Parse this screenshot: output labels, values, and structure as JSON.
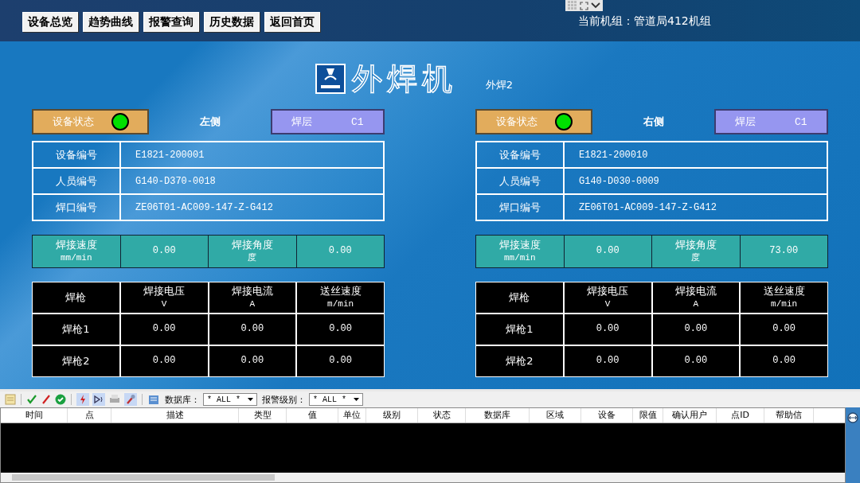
{
  "top_bar": {
    "nav_buttons": [
      "设备总览",
      "趋势曲线",
      "报警查询",
      "历史数据",
      "返回首页"
    ],
    "current_unit": "当前机组：管道局412机组"
  },
  "title": {
    "text": "外焊机",
    "subtitle": "外焊2"
  },
  "sides": [
    {
      "status_label": "设备状态",
      "status_on": true,
      "side_label": "左侧",
      "layer_label": "焊层",
      "layer_value": "C1",
      "info": [
        {
          "label": "设备编号",
          "value": "E1821-200001"
        },
        {
          "label": "人员编号",
          "value": "G140-D370-0018"
        },
        {
          "label": "焊口编号",
          "value": "ZE06T01-AC009-147-Z-G412"
        }
      ],
      "measures": [
        {
          "label": "焊接速度",
          "unit": "mm/min",
          "value": "0.00"
        },
        {
          "label": "焊接角度",
          "unit": "度",
          "value": "0.00"
        }
      ],
      "gun_columns": [
        {
          "label": "焊枪"
        },
        {
          "label": "焊接电压",
          "unit": "V"
        },
        {
          "label": "焊接电流",
          "unit": "A"
        },
        {
          "label": "送丝速度",
          "unit": "m/min"
        }
      ],
      "guns": [
        [
          "焊枪1",
          "0.00",
          "0.00",
          "0.00"
        ],
        [
          "焊枪2",
          "0.00",
          "0.00",
          "0.00"
        ]
      ]
    },
    {
      "status_label": "设备状态",
      "status_on": true,
      "side_label": "右侧",
      "layer_label": "焊层",
      "layer_value": "C1",
      "info": [
        {
          "label": "设备编号",
          "value": "E1821-200010"
        },
        {
          "label": "人员编号",
          "value": "G140-D030-0009"
        },
        {
          "label": "焊口编号",
          "value": "ZE06T01-AC009-147-Z-G412"
        }
      ],
      "measures": [
        {
          "label": "焊接速度",
          "unit": "mm/min",
          "value": "0.00"
        },
        {
          "label": "焊接角度",
          "unit": "度",
          "value": "73.00"
        }
      ],
      "gun_columns": [
        {
          "label": "焊枪"
        },
        {
          "label": "焊接电压",
          "unit": "V"
        },
        {
          "label": "焊接电流",
          "unit": "A"
        },
        {
          "label": "送丝速度",
          "unit": "m/min"
        }
      ],
      "guns": [
        [
          "焊枪1",
          "0.00",
          "0.00",
          "0.00"
        ],
        [
          "焊枪2",
          "0.00",
          "0.00",
          "0.00"
        ]
      ]
    }
  ],
  "alarm_panel": {
    "filters": [
      {
        "label": "数据库：",
        "value": "* ALL *"
      },
      {
        "label": "报警级别：",
        "value": "* ALL *"
      }
    ],
    "columns": [
      "时间",
      "点",
      "描述",
      "类型",
      "值",
      "单位",
      "级别",
      "状态",
      "数据库",
      "区域",
      "设备",
      "限值",
      "确认用户",
      "点ID",
      "帮助信"
    ]
  }
}
